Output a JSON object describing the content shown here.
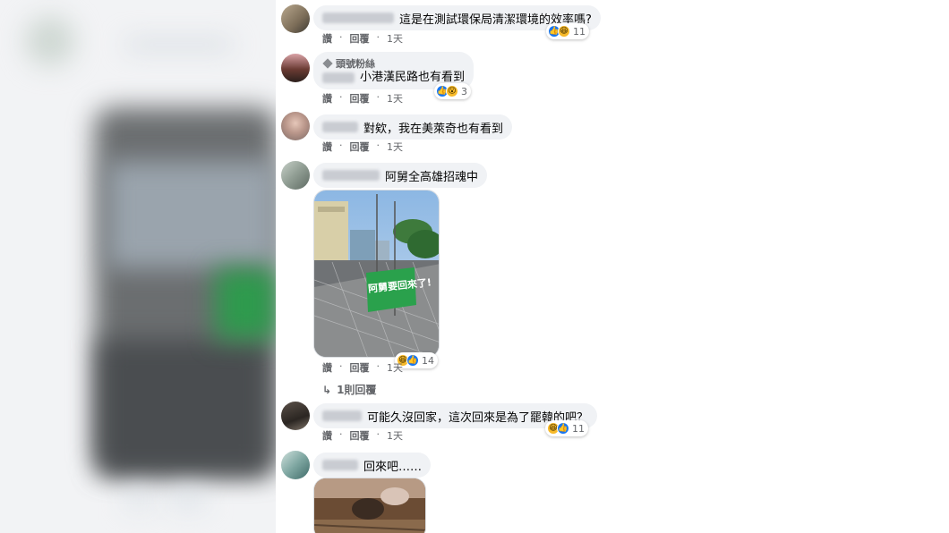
{
  "comments": [
    {
      "text": "這是在測試環保局清潔環境的效率嗎?",
      "actions": {
        "like": "讚",
        "reply": "回覆",
        "time": "1天"
      },
      "reactions": {
        "icons": [
          "like-icon",
          "haha-icon"
        ],
        "count": "11"
      }
    },
    {
      "badge": "頭號粉絲",
      "text": "小港漢民路也有看到",
      "actions": {
        "like": "讚",
        "reply": "回覆",
        "time": "1天"
      },
      "reactions": {
        "icons": [
          "like-icon",
          "wow-icon"
        ],
        "count": "3"
      }
    },
    {
      "text": "對欸，我在美萊奇也有看到",
      "actions": {
        "like": "讚",
        "reply": "回覆",
        "time": "1天"
      }
    },
    {
      "text": "阿舅全高雄招魂中",
      "photo_banner": "阿舅要回來了!",
      "actions": {
        "like": "讚",
        "reply": "回覆",
        "time": "1天"
      },
      "reactions": {
        "icons": [
          "haha-icon",
          "like-icon"
        ],
        "count": "14"
      }
    },
    {
      "text": "可能久沒回家，這次回來是為了罷韓的吧？",
      "actions": {
        "like": "讚",
        "reply": "回覆",
        "time": "1天"
      },
      "reactions": {
        "icons": [
          "haha-icon",
          "like-icon"
        ],
        "count": "11"
      }
    },
    {
      "text": "回來吧……"
    }
  ],
  "replies_link": "1則回覆",
  "colors": {
    "bubble": "#f0f2f5",
    "meta_text": "#65676b",
    "like_blue": "#1877f2",
    "haha_yellow": "#f7b928",
    "banner_green": "#2aa14c"
  }
}
